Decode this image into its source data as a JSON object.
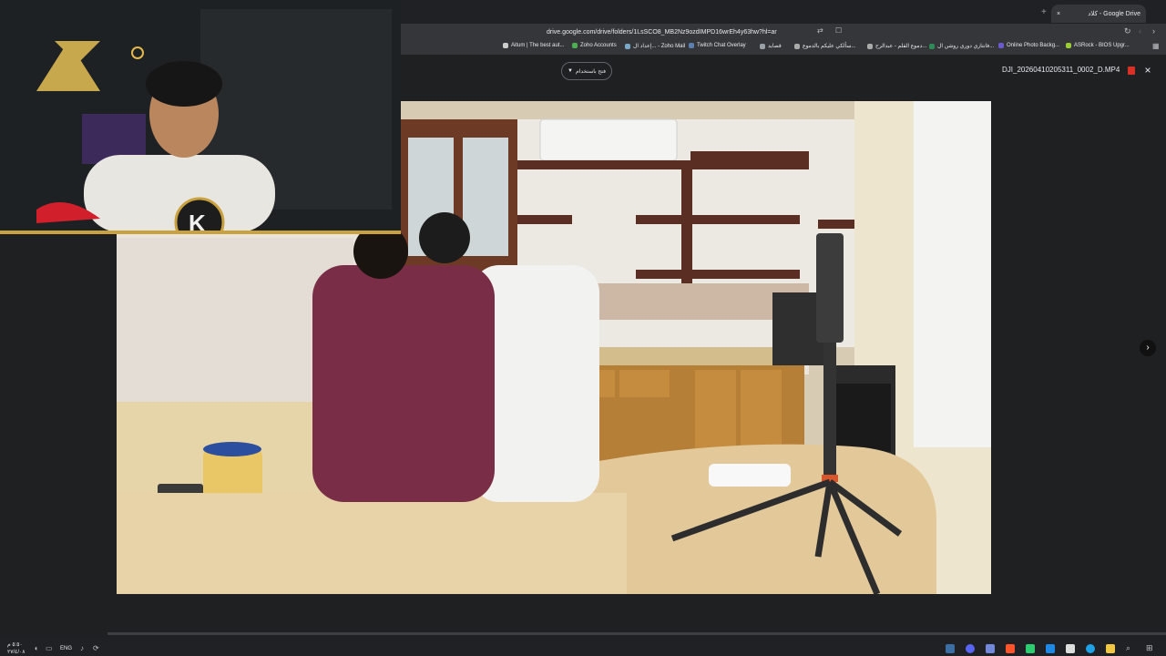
{
  "browser": {
    "tab_title": "كلاد - Google Drive",
    "tab_close": "×",
    "new_tab": "+",
    "url": "drive.google.com/drive/folders/1LsSCO8_MB2Nz9ozdIMPD16wrEh4y63hw?hl=ar",
    "bookmarks": [
      {
        "label": "ASRock - BIOS Upgr...",
        "icon": "asrock-icon",
        "color": "#9acd32"
      },
      {
        "label": "Online Photo Backg...",
        "icon": "photo-icon",
        "color": "#6a5acd"
      },
      {
        "label": "فانتازي دوري روشن ال...",
        "icon": "fantasy-icon",
        "color": "#2e8b57"
      },
      {
        "label": "دموع القلم - عبدالرح...",
        "icon": "pen-icon",
        "color": "#aaaaaa"
      },
      {
        "label": "سألكي عليكم بالدموع...",
        "icon": "pen-icon",
        "color": "#aaaaaa"
      },
      {
        "label": "قصايد",
        "icon": "folder-icon",
        "color": "#9aa0a6"
      },
      {
        "label": "Twitch Chat Overlay",
        "icon": "twitch-icon",
        "color": "#5a7fb0"
      },
      {
        "label": "إعداد ال... - Zoho Mail",
        "icon": "zoho-icon",
        "color": "#7aa7c7"
      },
      {
        "label": "Zoho Accounts",
        "icon": "zoho-icon",
        "color": "#4caf50"
      },
      {
        "label": "Aitum | The best aut...",
        "icon": "aitum-icon",
        "color": "#cccccc"
      }
    ]
  },
  "preview": {
    "open_with": "فتح باستخدام",
    "filename": "DJI_20260410205311_0002_D.MP4",
    "close": "×",
    "next": "›"
  },
  "taskbar": {
    "time": "٥:٥٠ م",
    "date": "٢٧/٤/٠٨",
    "lang": "ENG"
  },
  "colors": {
    "accent_gold": "#c9a13f",
    "drive_dark": "#1f2022"
  }
}
